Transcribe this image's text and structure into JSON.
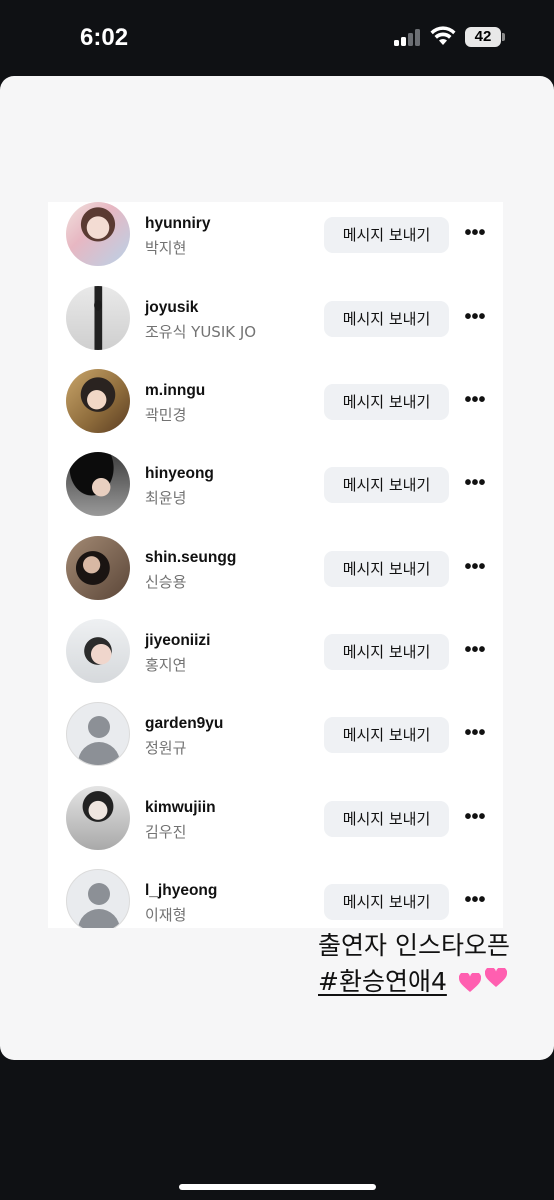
{
  "status_bar": {
    "time": "6:02",
    "battery": "42",
    "icons": [
      "cellular-signal-icon",
      "wifi-icon",
      "battery-icon"
    ]
  },
  "list": {
    "button_label": "메시지 보내기",
    "more_label": "•••",
    "rows": [
      {
        "username": "hyunniry",
        "name": "박지현"
      },
      {
        "username": "joyusik",
        "name": "조유식 YUSIK JO"
      },
      {
        "username": "m.inngu",
        "name": "곽민경"
      },
      {
        "username": "hinyeong",
        "name": "최윤녕"
      },
      {
        "username": "shin.seungg",
        "name": "신승용"
      },
      {
        "username": "jiyeoniizi",
        "name": "홍지연"
      },
      {
        "username": "garden9yu",
        "name": "정원규"
      },
      {
        "username": "kimwujiin",
        "name": "김우진"
      },
      {
        "username": "l_jhyeong",
        "name": "이재형"
      }
    ]
  },
  "caption": {
    "line1": "출연자 인스타오픈",
    "hashtag": "#환승연애4",
    "emoji": "💕💕"
  },
  "colors": {
    "background": "#0f1114",
    "card": "#f6f6f7",
    "button_bg": "#eff1f4",
    "secondary_text": "#737373",
    "heart": "#ff5fb0"
  }
}
